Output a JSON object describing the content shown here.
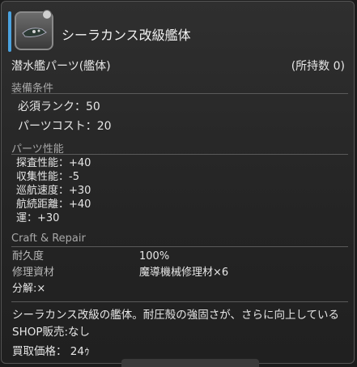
{
  "item": {
    "name": "シーラカンス改級艦体",
    "type": "潜水艦パーツ(艦体)",
    "owned": "(所持数 0)"
  },
  "equip": {
    "heading": "装備条件",
    "rank": "必須ランク：50",
    "cost": "パーツコスト：20"
  },
  "performance": {
    "heading": "パーツ性能",
    "stats": [
      "探査性能：+40",
      "収集性能：-5",
      "巡航速度：+30",
      "航続距離：+40",
      "運：+30"
    ]
  },
  "craft": {
    "heading": "Craft & Repair",
    "durability_label": "耐久度",
    "durability_value": "100%",
    "repair_label": "修理資材",
    "repair_value": "魔導機械修理材×6",
    "desynth": "分解:×"
  },
  "footer": {
    "description": "シーラカンス改級の艦体。耐圧殻の強固さが、さらに向上している",
    "shop": "SHOP販売:なし",
    "sell_price": "買取価格： 24ｩ"
  },
  "icons": {
    "item_icon": "submarine-hull-icon"
  },
  "colors": {
    "accent": "#4aa3e0"
  }
}
